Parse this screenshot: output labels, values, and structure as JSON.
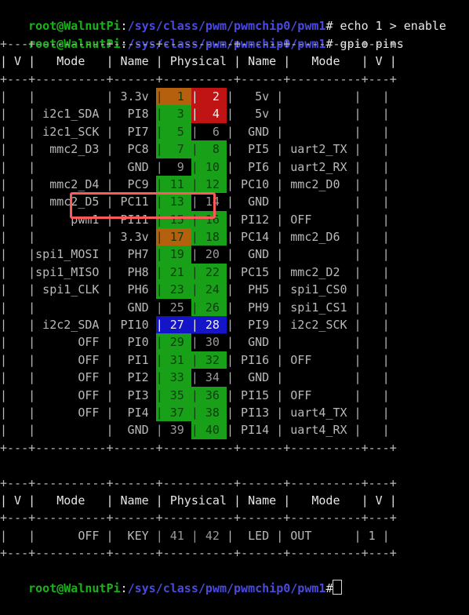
{
  "terminal": {
    "prompt_user_host": "root@WalnutPi",
    "prompt_colon": ":",
    "prompt_path": "/sys/class/pwm/pwmchip0/pwm1",
    "prompt_hash": "# ",
    "commands": [
      "echo 1 > enable",
      "gpio pins"
    ],
    "final_prompt_hash": "#",
    "cursor": " "
  },
  "table": {
    "separator": "+---+----------+------+----------+------+----------+---+",
    "header": {
      "v_left": "V",
      "mode_left": "Mode",
      "name_left": "Name",
      "physical": "Physical",
      "name_right": "Name",
      "mode_right": "Mode",
      "v_right": "V"
    },
    "rows": [
      {
        "vl": "",
        "model": "",
        "namel": "3.3v",
        "pinl": "1",
        "pinl_bg": "orange",
        "pinl_fg": "dark",
        "pinr": "2",
        "pinr_bg": "red",
        "pinr_fg": "white",
        "namer": "5v",
        "moder": "",
        "vr": ""
      },
      {
        "vl": "",
        "model": "i2c1_SDA",
        "namel": "PI8",
        "pinl": "3",
        "pinl_bg": "green",
        "pinl_fg": "dark",
        "pinr": "4",
        "pinr_bg": "red",
        "pinr_fg": "white",
        "namer": "5v",
        "moder": "",
        "vr": ""
      },
      {
        "vl": "",
        "model": "i2c1_SCK",
        "namel": "PI7",
        "pinl": "5",
        "pinl_bg": "green",
        "pinl_fg": "dark",
        "pinr": "6",
        "pinr_bg": "none",
        "pinr_fg": "grey",
        "namer": "GND",
        "moder": "",
        "vr": ""
      },
      {
        "vl": "",
        "model": "mmc2_D3",
        "namel": "PC8",
        "pinl": "7",
        "pinl_bg": "green",
        "pinl_fg": "dark",
        "pinr": "8",
        "pinr_bg": "green",
        "pinr_fg": "dark",
        "namer": "PI5",
        "moder": "uart2_TX",
        "vr": ""
      },
      {
        "vl": "",
        "model": "",
        "namel": "GND",
        "pinl": "9",
        "pinl_bg": "none",
        "pinl_fg": "grey",
        "pinr": "10",
        "pinr_bg": "green",
        "pinr_fg": "dark",
        "namer": "PI6",
        "moder": "uart2_RX",
        "vr": ""
      },
      {
        "vl": "",
        "model": "mmc2_D4",
        "namel": "PC9",
        "pinl": "11",
        "pinl_bg": "green",
        "pinl_fg": "dark",
        "pinr": "12",
        "pinr_bg": "green",
        "pinr_fg": "dark",
        "namer": "PC10",
        "moder": "mmc2_D0",
        "vr": ""
      },
      {
        "vl": "",
        "model": "mmc2_D5",
        "namel": "PC11",
        "pinl": "13",
        "pinl_bg": "green",
        "pinl_fg": "dark",
        "pinr": "14",
        "pinr_bg": "none",
        "pinr_fg": "grey",
        "namer": "GND",
        "moder": "",
        "vr": ""
      },
      {
        "vl": "",
        "model": "pwm1",
        "namel": "PI11",
        "pinl": "15",
        "pinl_bg": "green",
        "pinl_fg": "dark",
        "pinr": "16",
        "pinr_bg": "green",
        "pinr_fg": "dark",
        "namer": "PI12",
        "moder": "OFF",
        "vr": ""
      },
      {
        "vl": "",
        "model": "",
        "namel": "3.3v",
        "pinl": "17",
        "pinl_bg": "orange",
        "pinl_fg": "dark",
        "pinr": "18",
        "pinr_bg": "green",
        "pinr_fg": "dark",
        "namer": "PC14",
        "moder": "mmc2_D6",
        "vr": ""
      },
      {
        "vl": "",
        "model": "spi1_MOSI",
        "namel": "PH7",
        "pinl": "19",
        "pinl_bg": "green",
        "pinl_fg": "dark",
        "pinr": "20",
        "pinr_bg": "none",
        "pinr_fg": "grey",
        "namer": "GND",
        "moder": "",
        "vr": ""
      },
      {
        "vl": "",
        "model": "spi1_MISO",
        "namel": "PH8",
        "pinl": "21",
        "pinl_bg": "green",
        "pinl_fg": "dark",
        "pinr": "22",
        "pinr_bg": "green",
        "pinr_fg": "dark",
        "namer": "PC15",
        "moder": "mmc2_D2",
        "vr": ""
      },
      {
        "vl": "",
        "model": "spi1_CLK",
        "namel": "PH6",
        "pinl": "23",
        "pinl_bg": "green",
        "pinl_fg": "dark",
        "pinr": "24",
        "pinr_bg": "green",
        "pinr_fg": "dark",
        "namer": "PH5",
        "moder": "spi1_CS0",
        "vr": ""
      },
      {
        "vl": "",
        "model": "",
        "namel": "GND",
        "pinl": "25",
        "pinl_bg": "none",
        "pinl_fg": "grey",
        "pinr": "26",
        "pinr_bg": "green",
        "pinr_fg": "dark",
        "namer": "PH9",
        "moder": "spi1_CS1",
        "vr": ""
      },
      {
        "vl": "",
        "model": "i2c2_SDA",
        "namel": "PI10",
        "pinl": "27",
        "pinl_bg": "blue",
        "pinl_fg": "white",
        "pinr": "28",
        "pinr_bg": "blue",
        "pinr_fg": "white",
        "namer": "PI9",
        "moder": "i2c2_SCK",
        "vr": ""
      },
      {
        "vl": "",
        "model": "OFF",
        "namel": "PI0",
        "pinl": "29",
        "pinl_bg": "green",
        "pinl_fg": "dark",
        "pinr": "30",
        "pinr_bg": "none",
        "pinr_fg": "grey",
        "namer": "GND",
        "moder": "",
        "vr": ""
      },
      {
        "vl": "",
        "model": "OFF",
        "namel": "PI1",
        "pinl": "31",
        "pinl_bg": "green",
        "pinl_fg": "dark",
        "pinr": "32",
        "pinr_bg": "green",
        "pinr_fg": "dark",
        "namer": "PI16",
        "moder": "OFF",
        "vr": ""
      },
      {
        "vl": "",
        "model": "OFF",
        "namel": "PI2",
        "pinl": "33",
        "pinl_bg": "green",
        "pinl_fg": "dark",
        "pinr": "34",
        "pinr_bg": "none",
        "pinr_fg": "grey",
        "namer": "GND",
        "moder": "",
        "vr": ""
      },
      {
        "vl": "",
        "model": "OFF",
        "namel": "PI3",
        "pinl": "35",
        "pinl_bg": "green",
        "pinl_fg": "dark",
        "pinr": "36",
        "pinr_bg": "green",
        "pinr_fg": "dark",
        "namer": "PI15",
        "moder": "OFF",
        "vr": ""
      },
      {
        "vl": "",
        "model": "OFF",
        "namel": "PI4",
        "pinl": "37",
        "pinl_bg": "green",
        "pinl_fg": "dark",
        "pinr": "38",
        "pinr_bg": "green",
        "pinr_fg": "dark",
        "namer": "PI13",
        "moder": "uart4_TX",
        "vr": ""
      },
      {
        "vl": "",
        "model": "",
        "namel": "GND",
        "pinl": "39",
        "pinl_bg": "none",
        "pinl_fg": "grey",
        "pinr": "40",
        "pinr_bg": "green",
        "pinr_fg": "dark",
        "namer": "PI14",
        "moder": "uart4_RX",
        "vr": ""
      }
    ],
    "rows2": [
      {
        "vl": "",
        "model": "OFF",
        "namel": "KEY",
        "pinl": "41",
        "pinl_bg": "none",
        "pinl_fg": "grey",
        "pinr": "42",
        "pinr_bg": "none",
        "pinr_fg": "grey",
        "namer": "LED",
        "moder": "OUT",
        "vr": "1"
      }
    ]
  },
  "annotation": {
    "color": "#ff5a5a",
    "target_row_index": 7,
    "target_label": "pwm1 | PI11 | 15"
  },
  "colors": {
    "background": "#000000",
    "prompt_user": "#19b319",
    "prompt_path": "#4a4ae0",
    "gpio_green": "#18a018",
    "power_5v_red": "#c01414",
    "power_33v_orange": "#b5600d",
    "i2c_blue": "#1414c8",
    "annotation_red": "#ff5a5a"
  }
}
